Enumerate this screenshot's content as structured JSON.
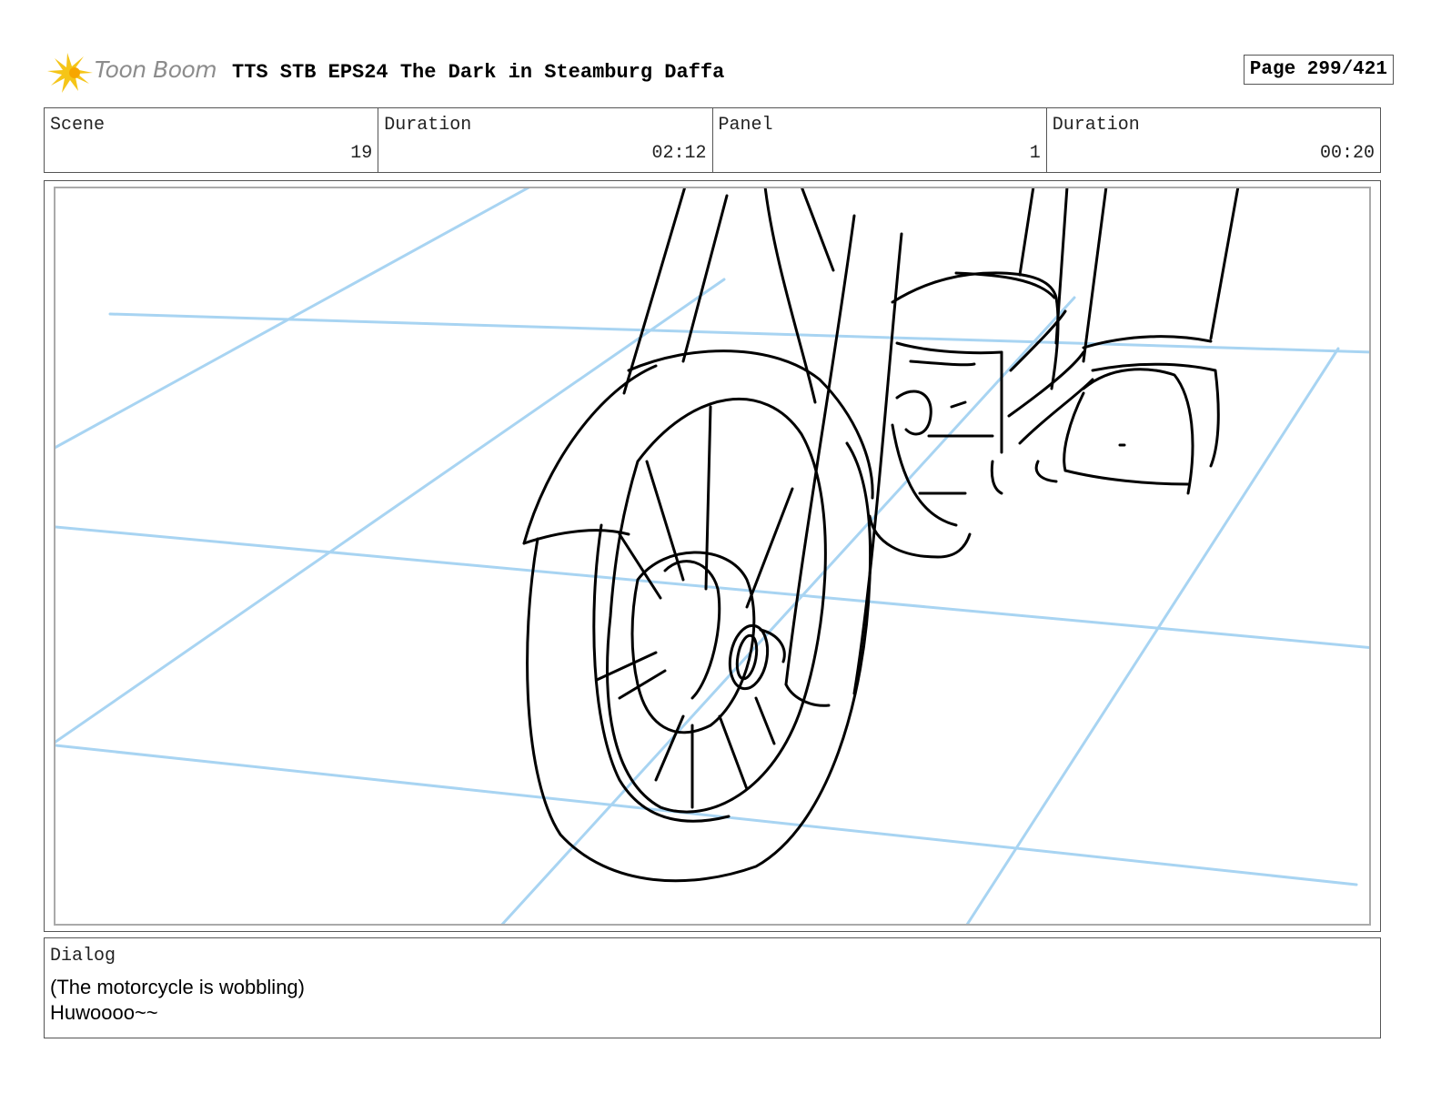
{
  "header": {
    "logo_text": "Toon Boom",
    "title": "TTS STB EPS24 The Dark in Steamburg Daffa",
    "page_label": "Page 299/421"
  },
  "info": {
    "scene_label": "Scene",
    "scene_value": "19",
    "scene_duration_label": "Duration",
    "scene_duration_value": "02:12",
    "panel_label": "Panel",
    "panel_value": "1",
    "panel_duration_label": "Duration",
    "panel_duration_value": "00:20"
  },
  "panel": {
    "image": "sketch-motorcycle-front-wheel",
    "guide_color": "#a8d4f2",
    "ink_color": "#000000"
  },
  "dialog": {
    "label": "Dialog",
    "line1": "(The motorcycle is wobbling)",
    "line2": "Huwoooo~~"
  },
  "colors": {
    "logo_star": "#f5c518",
    "logo_text": "#8c8c8c",
    "border": "#555555"
  }
}
